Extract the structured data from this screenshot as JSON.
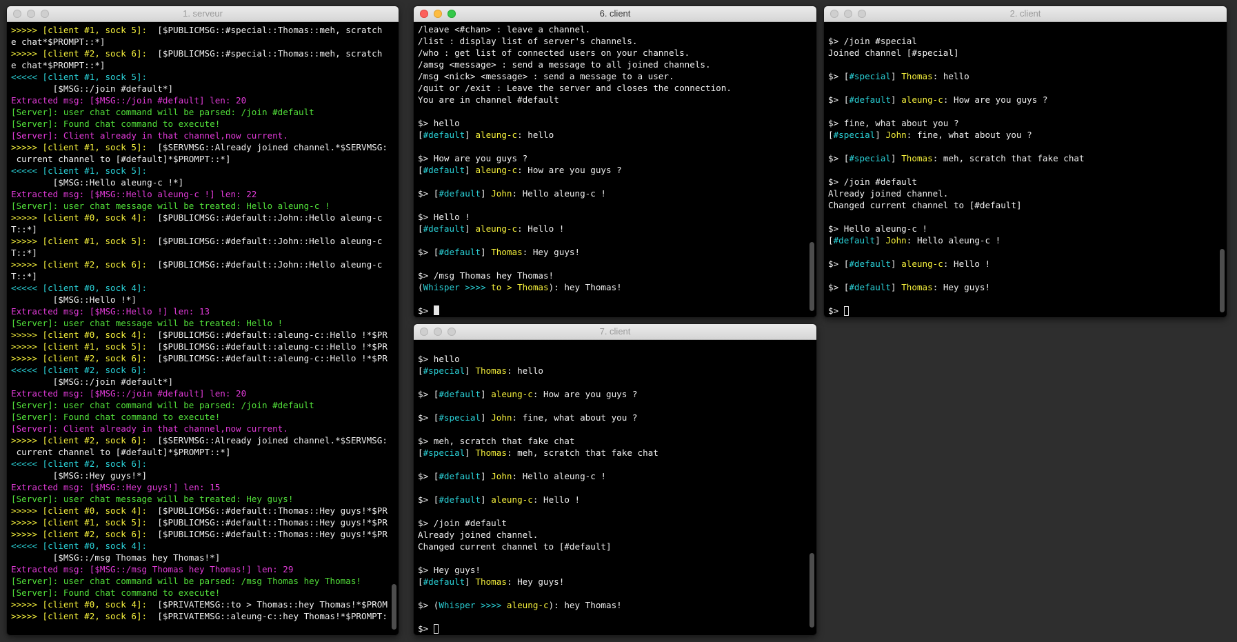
{
  "colors": {
    "default": "#f0f0f0",
    "yellow": "#f5f03c",
    "cyan": "#2ad0d6",
    "green": "#52e03a",
    "magenta": "#e23bd9"
  },
  "windows": [
    {
      "id": "serveur",
      "title": "1. serveur",
      "cursor": "hollow",
      "lines": [
        [
          [
            "yellow",
            ">>>>> [client #1, sock 5]:"
          ],
          [
            "default",
            "  [$PUBLICMSG::#special::Thomas::meh, scratch that fak"
          ]
        ],
        [
          [
            "default",
            "e chat*$PROMPT::*]"
          ]
        ],
        [
          [
            "yellow",
            ">>>>> [client #2, sock 6]:"
          ],
          [
            "default",
            "  [$PUBLICMSG::#special::Thomas::meh, scratch that fak"
          ]
        ],
        [
          [
            "default",
            "e chat*$PROMPT::*]"
          ]
        ],
        [
          [
            "cyan",
            "<<<<< [client #1, sock 5]:"
          ]
        ],
        [
          [
            "default",
            "        [$MSG::/join #default*]"
          ]
        ],
        [
          [
            "magenta",
            "Extracted msg: [$MSG::/join #default] len: 20"
          ]
        ],
        [
          [
            "green",
            "[Server]: user chat command will be parsed: /join #default"
          ]
        ],
        [
          [
            "green",
            "[Server]: Found chat command to execute!"
          ]
        ],
        [
          [
            "magenta",
            "[Server]: Client already in that channel,now current."
          ]
        ],
        [
          [
            "yellow",
            ">>>>> [client #1, sock 5]:"
          ],
          [
            "default",
            "  [$SERVMSG::Already joined channel.*$SERVMSG::Changed"
          ]
        ],
        [
          [
            "default",
            " current channel to [#default]*$PROMPT::*]"
          ]
        ],
        [
          [
            "cyan",
            "<<<<< [client #1, sock 5]:"
          ]
        ],
        [
          [
            "default",
            "        [$MSG::Hello aleung-c !*]"
          ]
        ],
        [
          [
            "magenta",
            "Extracted msg: [$MSG::Hello aleung-c !] len: 22"
          ]
        ],
        [
          [
            "green",
            "[Server]: user chat message will be treated: Hello aleung-c !"
          ]
        ],
        [
          [
            "yellow",
            ">>>>> [client #0, sock 4]:"
          ],
          [
            "default",
            "  [$PUBLICMSG::#default::John::Hello aleung-c !*$PROMP"
          ]
        ],
        [
          [
            "default",
            "T::*]"
          ]
        ],
        [
          [
            "yellow",
            ">>>>> [client #1, sock 5]:"
          ],
          [
            "default",
            "  [$PUBLICMSG::#default::John::Hello aleung-c !*$PROMP"
          ]
        ],
        [
          [
            "default",
            "T::*]"
          ]
        ],
        [
          [
            "yellow",
            ">>>>> [client #2, sock 6]:"
          ],
          [
            "default",
            "  [$PUBLICMSG::#default::John::Hello aleung-c !*$PROMP"
          ]
        ],
        [
          [
            "default",
            "T::*]"
          ]
        ],
        [
          [
            "cyan",
            "<<<<< [client #0, sock 4]:"
          ]
        ],
        [
          [
            "default",
            "        [$MSG::Hello !*]"
          ]
        ],
        [
          [
            "magenta",
            "Extracted msg: [$MSG::Hello !] len: 13"
          ]
        ],
        [
          [
            "green",
            "[Server]: user chat message will be treated: Hello !"
          ]
        ],
        [
          [
            "yellow",
            ">>>>> [client #0, sock 4]:"
          ],
          [
            "default",
            "  [$PUBLICMSG::#default::aleung-c::Hello !*$PROMPT::*]"
          ]
        ],
        [
          [
            "yellow",
            ">>>>> [client #1, sock 5]:"
          ],
          [
            "default",
            "  [$PUBLICMSG::#default::aleung-c::Hello !*$PROMPT::*]"
          ]
        ],
        [
          [
            "yellow",
            ">>>>> [client #2, sock 6]:"
          ],
          [
            "default",
            "  [$PUBLICMSG::#default::aleung-c::Hello !*$PROMPT::*]"
          ]
        ],
        [
          [
            "cyan",
            "<<<<< [client #2, sock 6]:"
          ]
        ],
        [
          [
            "default",
            "        [$MSG::/join #default*]"
          ]
        ],
        [
          [
            "magenta",
            "Extracted msg: [$MSG::/join #default] len: 20"
          ]
        ],
        [
          [
            "green",
            "[Server]: user chat command will be parsed: /join #default"
          ]
        ],
        [
          [
            "green",
            "[Server]: Found chat command to execute!"
          ]
        ],
        [
          [
            "magenta",
            "[Server]: Client already in that channel,now current."
          ]
        ],
        [
          [
            "yellow",
            ">>>>> [client #2, sock 6]:"
          ],
          [
            "default",
            "  [$SERVMSG::Already joined channel.*$SERVMSG::Changed"
          ]
        ],
        [
          [
            "default",
            " current channel to [#default]*$PROMPT::*]"
          ]
        ],
        [
          [
            "cyan",
            "<<<<< [client #2, sock 6]:"
          ]
        ],
        [
          [
            "default",
            "        [$MSG::Hey guys!*]"
          ]
        ],
        [
          [
            "magenta",
            "Extracted msg: [$MSG::Hey guys!] len: 15"
          ]
        ],
        [
          [
            "green",
            "[Server]: user chat message will be treated: Hey guys!"
          ]
        ],
        [
          [
            "yellow",
            ">>>>> [client #0, sock 4]:"
          ],
          [
            "default",
            "  [$PUBLICMSG::#default::Thomas::Hey guys!*$PROMPT::*]"
          ]
        ],
        [
          [
            "yellow",
            ">>>>> [client #1, sock 5]:"
          ],
          [
            "default",
            "  [$PUBLICMSG::#default::Thomas::Hey guys!*$PROMPT::*]"
          ]
        ],
        [
          [
            "yellow",
            ">>>>> [client #2, sock 6]:"
          ],
          [
            "default",
            "  [$PUBLICMSG::#default::Thomas::Hey guys!*$PROMPT::*]"
          ]
        ],
        [
          [
            "cyan",
            "<<<<< [client #0, sock 4]:"
          ]
        ],
        [
          [
            "default",
            "        [$MSG::/msg Thomas hey Thomas!*]"
          ]
        ],
        [
          [
            "magenta",
            "Extracted msg: [$MSG::/msg Thomas hey Thomas!] len: 29"
          ]
        ],
        [
          [
            "green",
            "[Server]: user chat command will be parsed: /msg Thomas hey Thomas!"
          ]
        ],
        [
          [
            "green",
            "[Server]: Found chat command to execute!"
          ]
        ],
        [
          [
            "yellow",
            ">>>>> [client #0, sock 4]:"
          ],
          [
            "default",
            "  [$PRIVATEMSG::to > Thomas::hey Thomas!*$PROMPT::*]"
          ]
        ],
        [
          [
            "yellow",
            ">>>>> [client #2, sock 6]:"
          ],
          [
            "default",
            "  [$PRIVATEMSG::aleung-c::hey Thomas!*$PROMPT::*]"
          ]
        ]
      ]
    },
    {
      "id": "client6",
      "title": "6. client",
      "cursor": "block",
      "lines": [
        [
          [
            "default",
            "/leave <#chan> : leave a channel."
          ]
        ],
        [
          [
            "default",
            "/list : display list of server's channels."
          ]
        ],
        [
          [
            "default",
            "/who : get list of connected users on your channels."
          ]
        ],
        [
          [
            "default",
            "/amsg <message> : send a message to all joined channels."
          ]
        ],
        [
          [
            "default",
            "/msg <nick> <message> : send a message to a user."
          ]
        ],
        [
          [
            "default",
            "/quit or /exit : Leave the server and closes the connection."
          ]
        ],
        [
          [
            "default",
            "You are in channel #default"
          ]
        ],
        [],
        [
          [
            "default",
            "$> hello"
          ]
        ],
        [
          [
            "default",
            "["
          ],
          [
            "cyan",
            "#default"
          ],
          [
            "default",
            "] "
          ],
          [
            "yellow",
            "aleung-c"
          ],
          [
            "default",
            ": hello"
          ]
        ],
        [],
        [
          [
            "default",
            "$> How are you guys ?"
          ]
        ],
        [
          [
            "default",
            "["
          ],
          [
            "cyan",
            "#default"
          ],
          [
            "default",
            "] "
          ],
          [
            "yellow",
            "aleung-c"
          ],
          [
            "default",
            ": How are you guys ?"
          ]
        ],
        [],
        [
          [
            "default",
            "$> ["
          ],
          [
            "cyan",
            "#default"
          ],
          [
            "default",
            "] "
          ],
          [
            "yellow",
            "John"
          ],
          [
            "default",
            ": Hello aleung-c !"
          ]
        ],
        [],
        [
          [
            "default",
            "$> Hello !"
          ]
        ],
        [
          [
            "default",
            "["
          ],
          [
            "cyan",
            "#default"
          ],
          [
            "default",
            "] "
          ],
          [
            "yellow",
            "aleung-c"
          ],
          [
            "default",
            ": Hello !"
          ]
        ],
        [],
        [
          [
            "default",
            "$> ["
          ],
          [
            "cyan",
            "#default"
          ],
          [
            "default",
            "] "
          ],
          [
            "yellow",
            "Thomas"
          ],
          [
            "default",
            ": Hey guys!"
          ]
        ],
        [],
        [
          [
            "default",
            "$> /msg Thomas hey Thomas!"
          ]
        ],
        [
          [
            "default",
            "("
          ],
          [
            "cyan",
            "Whisper >>>> "
          ],
          [
            "yellow",
            "to > Thomas"
          ],
          [
            "default",
            "): hey Thomas!"
          ]
        ],
        [],
        [
          [
            "default",
            "$> "
          ]
        ]
      ]
    },
    {
      "id": "client2",
      "title": "2. client",
      "cursor": "hollow",
      "lines": [
        [],
        [
          [
            "default",
            "$> /join #special"
          ]
        ],
        [
          [
            "default",
            "Joined channel [#special]"
          ]
        ],
        [],
        [
          [
            "default",
            "$> ["
          ],
          [
            "cyan",
            "#special"
          ],
          [
            "default",
            "] "
          ],
          [
            "yellow",
            "Thomas"
          ],
          [
            "default",
            ": hello"
          ]
        ],
        [],
        [
          [
            "default",
            "$> ["
          ],
          [
            "cyan",
            "#default"
          ],
          [
            "default",
            "] "
          ],
          [
            "yellow",
            "aleung-c"
          ],
          [
            "default",
            ": How are you guys ?"
          ]
        ],
        [],
        [
          [
            "default",
            "$> fine, what about you ?"
          ]
        ],
        [
          [
            "default",
            "["
          ],
          [
            "cyan",
            "#special"
          ],
          [
            "default",
            "] "
          ],
          [
            "yellow",
            "John"
          ],
          [
            "default",
            ": fine, what about you ?"
          ]
        ],
        [],
        [
          [
            "default",
            "$> ["
          ],
          [
            "cyan",
            "#special"
          ],
          [
            "default",
            "] "
          ],
          [
            "yellow",
            "Thomas"
          ],
          [
            "default",
            ": meh, scratch that fake chat"
          ]
        ],
        [],
        [
          [
            "default",
            "$> /join #default"
          ]
        ],
        [
          [
            "default",
            "Already joined channel."
          ]
        ],
        [
          [
            "default",
            "Changed current channel to [#default]"
          ]
        ],
        [],
        [
          [
            "default",
            "$> Hello aleung-c !"
          ]
        ],
        [
          [
            "default",
            "["
          ],
          [
            "cyan",
            "#default"
          ],
          [
            "default",
            "] "
          ],
          [
            "yellow",
            "John"
          ],
          [
            "default",
            ": Hello aleung-c !"
          ]
        ],
        [],
        [
          [
            "default",
            "$> ["
          ],
          [
            "cyan",
            "#default"
          ],
          [
            "default",
            "] "
          ],
          [
            "yellow",
            "aleung-c"
          ],
          [
            "default",
            ": Hello !"
          ]
        ],
        [],
        [
          [
            "default",
            "$> ["
          ],
          [
            "cyan",
            "#default"
          ],
          [
            "default",
            "] "
          ],
          [
            "yellow",
            "Thomas"
          ],
          [
            "default",
            ": Hey guys!"
          ]
        ],
        [],
        [
          [
            "default",
            "$> "
          ]
        ]
      ]
    },
    {
      "id": "client7",
      "title": "7. client",
      "cursor": "hollow",
      "lines": [
        [],
        [
          [
            "default",
            "$> hello"
          ]
        ],
        [
          [
            "default",
            "["
          ],
          [
            "cyan",
            "#special"
          ],
          [
            "default",
            "] "
          ],
          [
            "yellow",
            "Thomas"
          ],
          [
            "default",
            ": hello"
          ]
        ],
        [],
        [
          [
            "default",
            "$> ["
          ],
          [
            "cyan",
            "#default"
          ],
          [
            "default",
            "] "
          ],
          [
            "yellow",
            "aleung-c"
          ],
          [
            "default",
            ": How are you guys ?"
          ]
        ],
        [],
        [
          [
            "default",
            "$> ["
          ],
          [
            "cyan",
            "#special"
          ],
          [
            "default",
            "] "
          ],
          [
            "yellow",
            "John"
          ],
          [
            "default",
            ": fine, what about you ?"
          ]
        ],
        [],
        [
          [
            "default",
            "$> meh, scratch that fake chat"
          ]
        ],
        [
          [
            "default",
            "["
          ],
          [
            "cyan",
            "#special"
          ],
          [
            "default",
            "] "
          ],
          [
            "yellow",
            "Thomas"
          ],
          [
            "default",
            ": meh, scratch that fake chat"
          ]
        ],
        [],
        [
          [
            "default",
            "$> ["
          ],
          [
            "cyan",
            "#default"
          ],
          [
            "default",
            "] "
          ],
          [
            "yellow",
            "John"
          ],
          [
            "default",
            ": Hello aleung-c !"
          ]
        ],
        [],
        [
          [
            "default",
            "$> ["
          ],
          [
            "cyan",
            "#default"
          ],
          [
            "default",
            "] "
          ],
          [
            "yellow",
            "aleung-c"
          ],
          [
            "default",
            ": Hello !"
          ]
        ],
        [],
        [
          [
            "default",
            "$> /join #default"
          ]
        ],
        [
          [
            "default",
            "Already joined channel."
          ]
        ],
        [
          [
            "default",
            "Changed current channel to [#default]"
          ]
        ],
        [],
        [
          [
            "default",
            "$> Hey guys!"
          ]
        ],
        [
          [
            "default",
            "["
          ],
          [
            "cyan",
            "#default"
          ],
          [
            "default",
            "] "
          ],
          [
            "yellow",
            "Thomas"
          ],
          [
            "default",
            ": Hey guys!"
          ]
        ],
        [],
        [
          [
            "default",
            "$> ("
          ],
          [
            "cyan",
            "Whisper >>>> "
          ],
          [
            "yellow",
            "aleung-c"
          ],
          [
            "default",
            "): hey Thomas!"
          ]
        ],
        [],
        [
          [
            "default",
            "$> "
          ]
        ]
      ]
    }
  ]
}
